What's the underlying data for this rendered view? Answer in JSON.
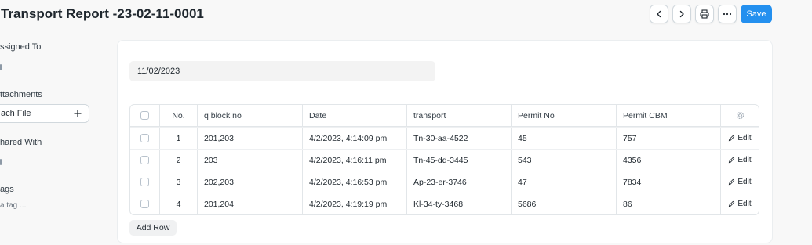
{
  "header": {
    "title": "Transport Report -23-02-11-0001",
    "save_label": "Save",
    "icons": [
      "chevron-left-icon",
      "chevron-right-icon",
      "printer-icon",
      "more-icon"
    ]
  },
  "sidebar": {
    "assigned_to_label": "ssigned To",
    "attachments_label": "ttachments",
    "attach_file_label": "ach File",
    "shared_with_label": "hared With",
    "tags_label": "ags",
    "add_tag_label": "a tag ..."
  },
  "form": {
    "date_value": "11/02/2023"
  },
  "table": {
    "columns": [
      "No.",
      "q block no",
      "Date",
      "transport",
      "Permit No",
      "Permit CBM"
    ],
    "edit_label": "Edit",
    "rows": [
      {
        "no": "1",
        "q_block_no": "201,203",
        "date": "4/2/2023, 4:14:09 pm",
        "transport": "Tn-30-aa-4522",
        "permit_no": "45",
        "permit_cbm": "757"
      },
      {
        "no": "2",
        "q_block_no": "203",
        "date": "4/2/2023, 4:16:11 pm",
        "transport": "Tn-45-dd-3445",
        "permit_no": "543",
        "permit_cbm": "4356"
      },
      {
        "no": "3",
        "q_block_no": "202,203",
        "date": "4/2/2023, 4:16:53 pm",
        "transport": "Ap-23-er-3746",
        "permit_no": "47",
        "permit_cbm": "7834"
      },
      {
        "no": "4",
        "q_block_no": "201,204",
        "date": "4/2/2023, 4:19:19 pm",
        "transport": "Kl-34-ty-3468",
        "permit_no": "5686",
        "permit_cbm": "86"
      }
    ],
    "add_row_label": "Add Row"
  },
  "colors": {
    "primary": "#2490ef",
    "border": "#d1d8dd",
    "text": "#1f272e"
  }
}
